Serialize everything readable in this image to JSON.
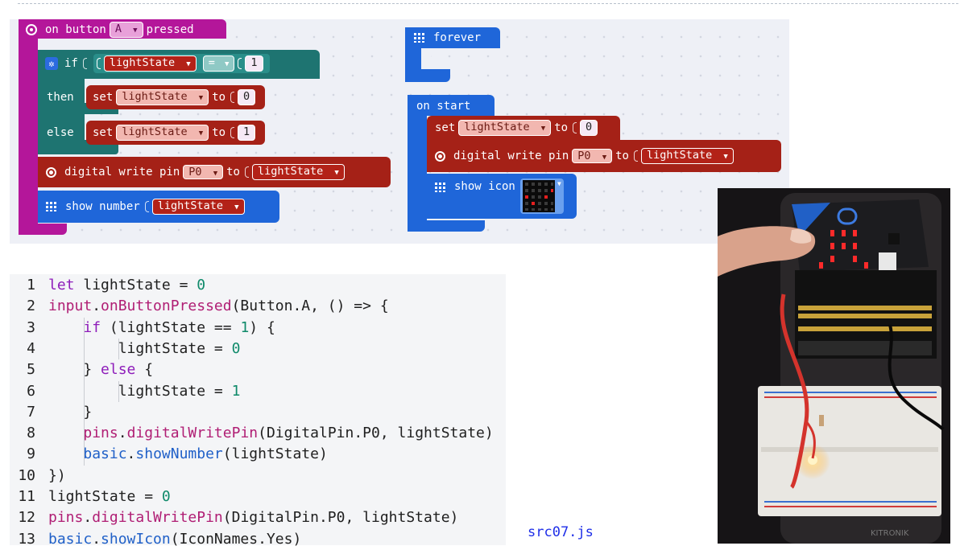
{
  "blocks": {
    "on_button": {
      "prefix": "on button",
      "button": "A",
      "suffix": "pressed"
    },
    "if_block": {
      "if_label": "if",
      "var": "lightState",
      "op": "=",
      "value": "1",
      "then_label": "then",
      "else_label": "else"
    },
    "set_then": {
      "set_label": "set",
      "var": "lightState",
      "to_label": "to",
      "value": "0"
    },
    "set_else": {
      "set_label": "set",
      "var": "lightState",
      "to_label": "to",
      "value": "1"
    },
    "digital_write": {
      "label": "digital write pin",
      "pin": "P0",
      "to_label": "to",
      "var": "lightState"
    },
    "show_number": {
      "label": "show number",
      "var": "lightState"
    },
    "forever": {
      "label": "forever"
    },
    "on_start": {
      "label": "on start"
    },
    "start_set": {
      "set_label": "set",
      "var": "lightState",
      "to_label": "to",
      "value": "0"
    },
    "start_write": {
      "label": "digital write pin",
      "pin": "P0",
      "to_label": "to",
      "var": "lightState"
    },
    "show_icon": {
      "label": "show icon"
    }
  },
  "code": {
    "lines": [
      {
        "n": "1",
        "segs": [
          {
            "t": "let ",
            "c": "k"
          },
          {
            "t": "lightState = ",
            "c": ""
          },
          {
            "t": "0",
            "c": "n"
          }
        ]
      },
      {
        "n": "2",
        "segs": [
          {
            "t": "input",
            "c": "m"
          },
          {
            "t": ".",
            "c": ""
          },
          {
            "t": "onButtonPressed",
            "c": "m"
          },
          {
            "t": "(Button.A, () => {",
            "c": ""
          }
        ]
      },
      {
        "n": "3",
        "segs": [
          {
            "t": "    ",
            "c": ""
          },
          {
            "t": "if",
            "c": "k"
          },
          {
            "t": " (lightState == ",
            "c": ""
          },
          {
            "t": "1",
            "c": "n"
          },
          {
            "t": ") {",
            "c": ""
          }
        ]
      },
      {
        "n": "4",
        "segs": [
          {
            "t": "        lightState = ",
            "c": ""
          },
          {
            "t": "0",
            "c": "n"
          }
        ]
      },
      {
        "n": "5",
        "segs": [
          {
            "t": "    } ",
            "c": ""
          },
          {
            "t": "else",
            "c": "k"
          },
          {
            "t": " {",
            "c": ""
          }
        ]
      },
      {
        "n": "6",
        "segs": [
          {
            "t": "        lightState = ",
            "c": ""
          },
          {
            "t": "1",
            "c": "n"
          }
        ]
      },
      {
        "n": "7",
        "segs": [
          {
            "t": "    }",
            "c": ""
          }
        ]
      },
      {
        "n": "8",
        "segs": [
          {
            "t": "    ",
            "c": ""
          },
          {
            "t": "pins",
            "c": "m"
          },
          {
            "t": ".",
            "c": ""
          },
          {
            "t": "digitalWritePin",
            "c": "m"
          },
          {
            "t": "(DigitalPin.P0, lightState)",
            "c": ""
          }
        ]
      },
      {
        "n": "9",
        "segs": [
          {
            "t": "    ",
            "c": ""
          },
          {
            "t": "basic",
            "c": "f"
          },
          {
            "t": ".",
            "c": ""
          },
          {
            "t": "showNumber",
            "c": "f"
          },
          {
            "t": "(lightState)",
            "c": ""
          }
        ]
      },
      {
        "n": "10",
        "segs": [
          {
            "t": "})",
            "c": ""
          }
        ]
      },
      {
        "n": "11",
        "segs": [
          {
            "t": "lightState = ",
            "c": ""
          },
          {
            "t": "0",
            "c": "n"
          }
        ]
      },
      {
        "n": "12",
        "segs": [
          {
            "t": "pins",
            "c": "m"
          },
          {
            "t": ".",
            "c": ""
          },
          {
            "t": "digitalWritePin",
            "c": "m"
          },
          {
            "t": "(DigitalPin.P0, lightState)",
            "c": ""
          }
        ]
      },
      {
        "n": "13",
        "segs": [
          {
            "t": "basic",
            "c": "f"
          },
          {
            "t": ".",
            "c": ""
          },
          {
            "t": "showIcon",
            "c": "f"
          },
          {
            "t": "(IconNames.Yes)",
            "c": ""
          }
        ]
      }
    ]
  },
  "file_label": "src07.js",
  "colors": {
    "events": "#b4169a",
    "logic": "#1e7471",
    "variables": "#a52117",
    "pins": "#a52117",
    "basic": "#1f66d9",
    "workspace": "#eef0f6",
    "code_bg": "#f4f5f7"
  },
  "icons": [
    "target-icon",
    "gear-icon",
    "grid-icon",
    "pin-icon",
    "dropdown-caret-icon"
  ]
}
